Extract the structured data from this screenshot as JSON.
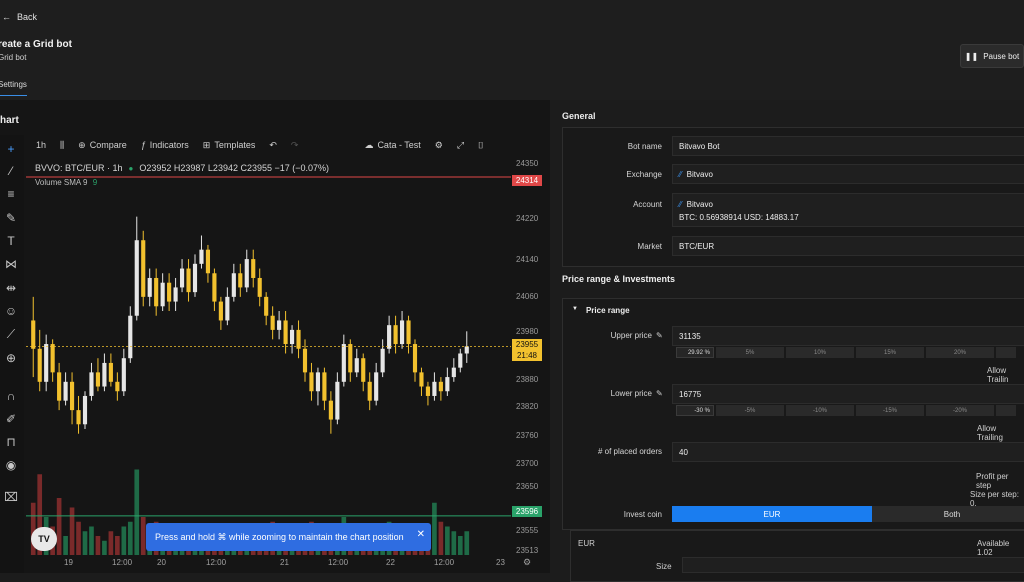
{
  "header": {
    "back_label": "Back",
    "title": "reate a Grid bot",
    "subtitle": "Grid bot",
    "tab_label": "Settings",
    "pause_label": "Pause bot"
  },
  "chart": {
    "heading": "hart",
    "interval": "1h",
    "compare": "Compare",
    "indicators": "Indicators",
    "templates": "Templates",
    "layout": "Cata - Test",
    "symbol": "BVVO: BTC/EUR · 1h",
    "ohlc": "O23952 H23987 L23942 C23955 −17 (−0.07%)",
    "volume_label": "Volume SMA 9",
    "volume_value": "9",
    "price_labels": [
      "24350",
      "24220",
      "24140",
      "24060",
      "23980",
      "23880",
      "23820",
      "23760",
      "23700",
      "23650",
      "23555",
      "23513"
    ],
    "time_labels": [
      "19",
      "12:00",
      "20",
      "12:00",
      "21",
      "12:00",
      "22",
      "12:00",
      "23"
    ],
    "marker_high": "24314",
    "marker_last": "23955",
    "marker_countdown": "21:48",
    "marker_low": "23596",
    "toast": "Press and hold ⌘ while zooming to maintain the chart position",
    "logo": "TV",
    "colors": {
      "up": "#e6e6e6",
      "down": "#f2c12e",
      "high_line": "#e04848",
      "low_line": "#2aa36a",
      "last": "#f2c12e"
    }
  },
  "chart_data": {
    "type": "candlestick",
    "ylim": [
      23513,
      24350
    ],
    "candles": [
      [
        24010,
        23950,
        24060,
        23890
      ],
      [
        23950,
        23880,
        23990,
        23860
      ],
      [
        23880,
        23960,
        23980,
        23860
      ],
      [
        23960,
        23900,
        23970,
        23880
      ],
      [
        23900,
        23840,
        23920,
        23820
      ],
      [
        23840,
        23880,
        23900,
        23830
      ],
      [
        23880,
        23820,
        23900,
        23790
      ],
      [
        23820,
        23790,
        23850,
        23770
      ],
      [
        23790,
        23850,
        23860,
        23780
      ],
      [
        23850,
        23900,
        23920,
        23840
      ],
      [
        23900,
        23870,
        23930,
        23860
      ],
      [
        23870,
        23920,
        23940,
        23860
      ],
      [
        23920,
        23880,
        23940,
        23870
      ],
      [
        23880,
        23860,
        23900,
        23840
      ],
      [
        23860,
        23930,
        23950,
        23850
      ],
      [
        23930,
        24020,
        24040,
        23920
      ],
      [
        24020,
        24180,
        24230,
        24010
      ],
      [
        24180,
        24060,
        24200,
        24040
      ],
      [
        24060,
        24100,
        24120,
        24040
      ],
      [
        24100,
        24040,
        24120,
        24020
      ],
      [
        24040,
        24090,
        24110,
        24030
      ],
      [
        24090,
        24050,
        24110,
        24030
      ],
      [
        24050,
        24080,
        24100,
        24030
      ],
      [
        24080,
        24120,
        24140,
        24070
      ],
      [
        24120,
        24070,
        24140,
        24050
      ],
      [
        24070,
        24130,
        24150,
        24060
      ],
      [
        24130,
        24160,
        24190,
        24120
      ],
      [
        24160,
        24110,
        24170,
        24090
      ],
      [
        24110,
        24050,
        24120,
        24030
      ],
      [
        24050,
        24010,
        24060,
        23990
      ],
      [
        24010,
        24060,
        24080,
        24000
      ],
      [
        24060,
        24110,
        24130,
        24050
      ],
      [
        24110,
        24080,
        24130,
        24060
      ],
      [
        24080,
        24140,
        24160,
        24070
      ],
      [
        24140,
        24100,
        24160,
        24080
      ],
      [
        24100,
        24060,
        24120,
        24040
      ],
      [
        24060,
        24020,
        24070,
        24000
      ],
      [
        24020,
        23990,
        24040,
        23970
      ],
      [
        23990,
        24010,
        24030,
        23970
      ],
      [
        24010,
        23960,
        24030,
        23940
      ],
      [
        23960,
        23990,
        24000,
        23940
      ],
      [
        23990,
        23950,
        24010,
        23930
      ],
      [
        23950,
        23900,
        23970,
        23880
      ],
      [
        23900,
        23860,
        23920,
        23840
      ],
      [
        23860,
        23900,
        23910,
        23830
      ],
      [
        23900,
        23840,
        23910,
        23820
      ],
      [
        23840,
        23800,
        23860,
        23770
      ],
      [
        23800,
        23880,
        23900,
        23790
      ],
      [
        23880,
        23960,
        23980,
        23870
      ],
      [
        23960,
        23900,
        23970,
        23880
      ],
      [
        23900,
        23930,
        23950,
        23890
      ],
      [
        23930,
        23880,
        23940,
        23860
      ],
      [
        23880,
        23840,
        23900,
        23820
      ],
      [
        23840,
        23900,
        23920,
        23830
      ],
      [
        23900,
        23950,
        23970,
        23890
      ],
      [
        23950,
        24000,
        24020,
        23940
      ],
      [
        24000,
        23960,
        24020,
        23940
      ],
      [
        23960,
        24010,
        24030,
        23950
      ],
      [
        24010,
        23960,
        24020,
        23940
      ],
      [
        23960,
        23900,
        23970,
        23880
      ],
      [
        23900,
        23870,
        23910,
        23850
      ],
      [
        23870,
        23850,
        23880,
        23830
      ],
      [
        23850,
        23880,
        23900,
        23840
      ],
      [
        23880,
        23860,
        23890,
        23840
      ],
      [
        23860,
        23890,
        23910,
        23850
      ],
      [
        23890,
        23910,
        23930,
        23880
      ],
      [
        23910,
        23940,
        23950,
        23900
      ],
      [
        23940,
        23955,
        23987,
        23920
      ]
    ],
    "volumes": [
      0.55,
      0.85,
      0.4,
      0.3,
      0.6,
      0.2,
      0.5,
      0.35,
      0.25,
      0.3,
      0.2,
      0.15,
      0.25,
      0.2,
      0.3,
      0.35,
      0.9,
      0.4,
      0.3,
      0.35,
      0.2,
      0.25,
      0.15,
      0.2,
      0.3,
      0.25,
      0.2,
      0.3,
      0.25,
      0.2,
      0.15,
      0.25,
      0.2,
      0.3,
      0.25,
      0.2,
      0.3,
      0.35,
      0.25,
      0.2,
      0.3,
      0.25,
      0.2,
      0.35,
      0.3,
      0.25,
      0.2,
      0.3,
      0.4,
      0.25,
      0.2,
      0.3,
      0.25,
      0.2,
      0.3,
      0.35,
      0.25,
      0.2,
      0.3,
      0.25,
      0.2,
      0.3,
      0.55,
      0.35,
      0.3,
      0.25,
      0.2,
      0.25
    ]
  },
  "general": {
    "title": "General",
    "bot_name_label": "Bot name",
    "bot_name": "Bitvavo Bot",
    "exchange_label": "Exchange",
    "exchange": "Bitvavo",
    "account_label": "Account",
    "account": "Bitvavo",
    "account_balance": "BTC: 0.56938914   USD: 14883.17",
    "market_label": "Market",
    "market": "BTC/EUR"
  },
  "investments": {
    "title": "Price range & Investments",
    "price_range_label": "Price range",
    "upper_label": "Upper price",
    "upper_value": "31135",
    "upper_pct": "29.92",
    "upper_steps": [
      "5%",
      "10%",
      "15%",
      "20%"
    ],
    "allow_trailing_up": "Allow Trailin",
    "lower_label": "Lower price",
    "lower_value": "16775",
    "lower_pct": "-30",
    "lower_steps": [
      "-5%",
      "-10%",
      "-15%",
      "-20%"
    ],
    "allow_trailing_down": "Allow Trailing",
    "orders_label": "# of placed orders",
    "orders_value": "40",
    "profit_label": "Profit per step",
    "size_step_label": "Size per step: 0.",
    "invest_label": "Invest coin",
    "invest_options": [
      "EUR",
      "Both"
    ],
    "eur_label": "EUR",
    "available": "Available 1.02",
    "size_label": "Size"
  }
}
